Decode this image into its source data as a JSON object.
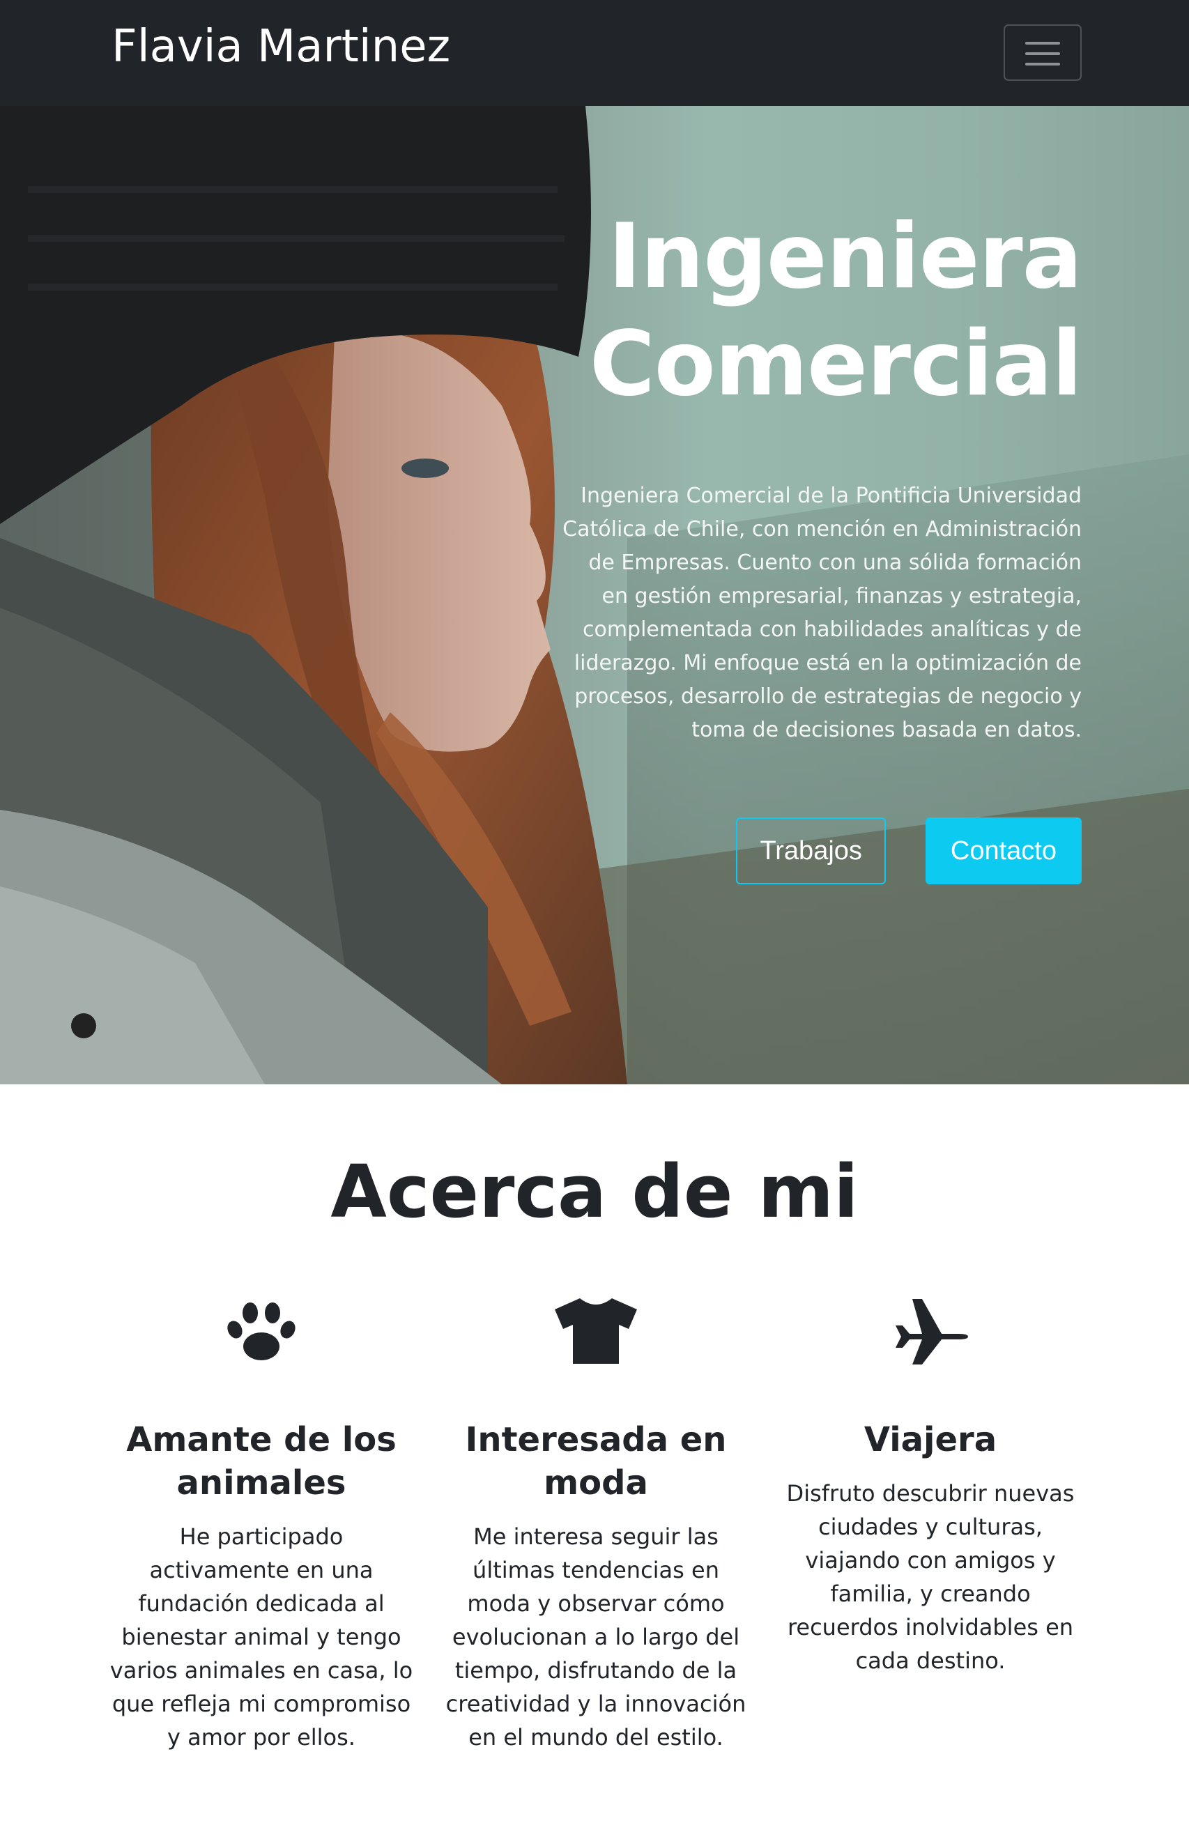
{
  "navbar": {
    "brand": "Flavia Martinez",
    "toggler_icon": "hamburger-icon"
  },
  "hero": {
    "title_line1": "Ingeniera",
    "title_line2": "Comercial",
    "description": "Ingeniera Comercial de la Pontificia Universidad Católica de Chile, con mención en Administración de Empresas. Cuento con una sólida formación en gestión empresarial, finanzas y estrategia, complementada con habilidades analíticas y de liderazgo. Mi enfoque está en la optimización de procesos, desarrollo de estrategias de negocio y toma de decisiones basada en datos.",
    "button_works": "Trabajos",
    "button_contact": "Contacto"
  },
  "about": {
    "title": "Acerca de mi",
    "features": [
      {
        "icon": "paw-icon",
        "title": "Amante de los animales",
        "text": "He participado activamente en una fundación dedicada al bienestar animal y tengo varios animales en casa, lo que refleja mi compromiso y amor por ellos."
      },
      {
        "icon": "tshirt-icon",
        "title": "Interesada en moda",
        "text": "Me interesa seguir las últimas tendencias en moda y observar cómo evolucionan a lo largo del tiempo, disfrutando de la creatividad y la innovación en el mundo del estilo."
      },
      {
        "icon": "plane-icon",
        "title": "Viajera",
        "text": "Disfruto descubrir nuevas ciudades y culturas, viajando con amigos y familia, y creando recuerdos inolvidables en cada destino."
      }
    ]
  },
  "colors": {
    "navbar": "#212529",
    "accent": "#0dcaf0",
    "text": "#212529"
  }
}
